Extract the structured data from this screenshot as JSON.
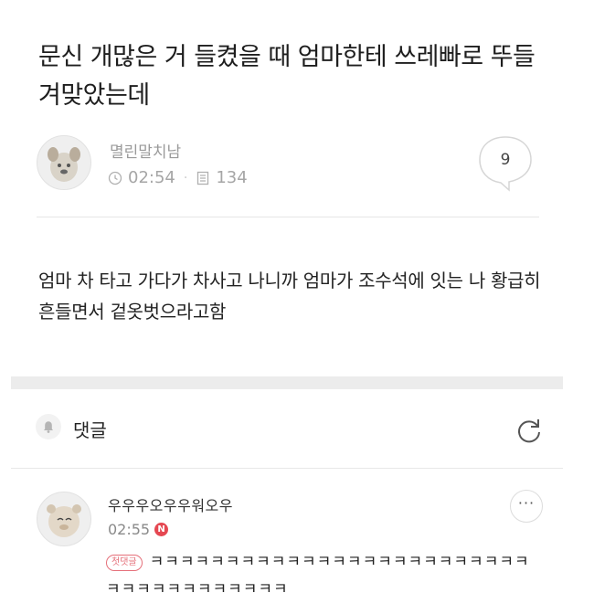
{
  "post": {
    "title": "문신 개많은 거 들켰을 때 엄마한테 쓰레빠로 뚜들겨맞았는데",
    "author": "멸린말치남",
    "time": "02:54",
    "views": "134",
    "comment_count": "9",
    "body": "엄마 차 타고 가다가 차사고 나니까 엄마가 조수석에 잇는 나 황급히 흔들면서 겉옷벗으라고함"
  },
  "comments_section": {
    "label": "댓글"
  },
  "comments": [
    {
      "author": "우우우오우우워오우",
      "time": "02:55",
      "new_badge": "N",
      "first_badge": "첫댓글",
      "text": "ㅋㅋㅋㅋㅋㅋㅋㅋㅋㅋㅋㅋㅋㅋㅋㅋㅋㅋㅋㅋㅋㅋㅋㅋㅋㅋㅋㅋㅋㅋㅋㅋㅋㅋㅋㅋㅋ",
      "more_label": "···"
    }
  ],
  "colors": {
    "accent_red": "#e54852",
    "divider": "#ececec",
    "muted_text": "#a6a6a6"
  },
  "icons": [
    "author-avatar-icon",
    "clock-icon",
    "views-icon",
    "comment-bubble-icon",
    "bell-icon",
    "refresh-icon",
    "commenter-avatar-icon",
    "more-icon"
  ]
}
